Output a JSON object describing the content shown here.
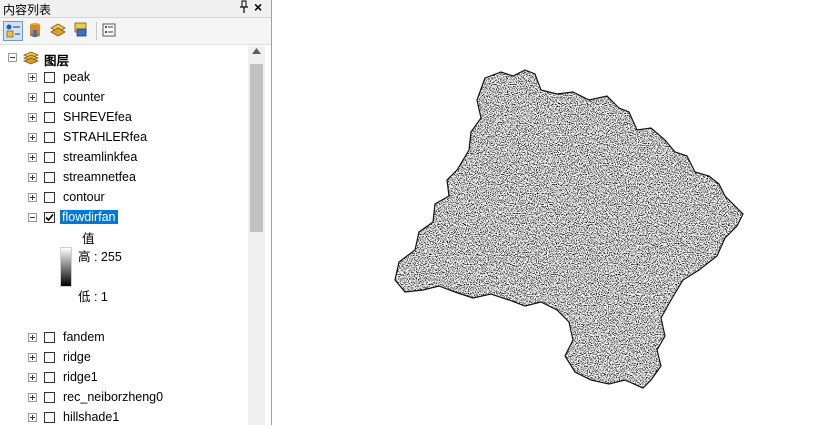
{
  "panel": {
    "title": "内容列表",
    "pin": "ᵖ",
    "close": "×"
  },
  "toolbar": {
    "buttons": [
      "list-by-drawing-order",
      "list-by-source",
      "list-by-visibility",
      "list-by-selection",
      "options"
    ]
  },
  "tree": {
    "root_label": "图层",
    "layers_top": [
      {
        "name": "peak",
        "checked": false
      },
      {
        "name": "counter",
        "checked": false
      },
      {
        "name": "SHREVEfea",
        "checked": false
      },
      {
        "name": "STRAHLERfea",
        "checked": false
      },
      {
        "name": "streamlinkfea",
        "checked": false
      },
      {
        "name": "streamnetfea",
        "checked": false
      },
      {
        "name": "contour",
        "checked": false
      }
    ],
    "active_layer": {
      "name": "flowdirfan",
      "checked": true,
      "legend": {
        "heading": "值",
        "high": "高 : 255",
        "low": "低 : 1"
      }
    },
    "layers_bottom": [
      {
        "name": "fandem",
        "checked": false
      },
      {
        "name": "ridge",
        "checked": false
      },
      {
        "name": "ridge1",
        "checked": false
      },
      {
        "name": "rec_neiborzheng0",
        "checked": false
      },
      {
        "name": "hillshade1",
        "checked": false
      }
    ]
  },
  "colors": {
    "selection": "#0078d7",
    "raster": "#000000",
    "panel_bg": "#f0f0f0"
  }
}
